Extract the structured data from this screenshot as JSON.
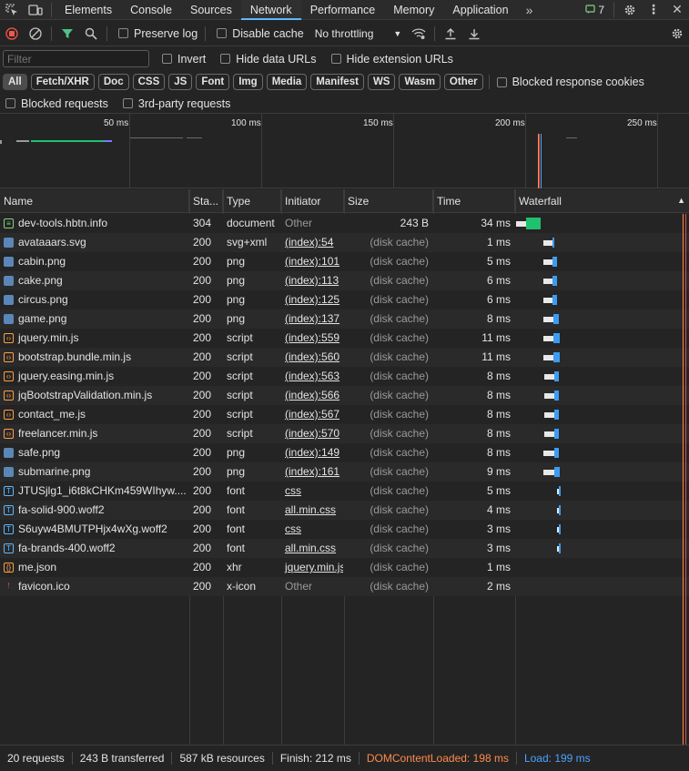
{
  "tabs": [
    "Elements",
    "Console",
    "Sources",
    "Network",
    "Performance",
    "Memory",
    "Application"
  ],
  "active_tab": "Network",
  "issues_count": "7",
  "toolbar": {
    "preserve_log": "Preserve log",
    "disable_cache": "Disable cache",
    "throttling": "No throttling"
  },
  "filter": {
    "placeholder": "Filter",
    "invert": "Invert",
    "hide_data_urls": "Hide data URLs",
    "hide_extension_urls": "Hide extension URLs"
  },
  "type_filters": [
    "All",
    "Fetch/XHR",
    "Doc",
    "CSS",
    "JS",
    "Font",
    "Img",
    "Media",
    "Manifest",
    "WS",
    "Wasm",
    "Other"
  ],
  "blocked_response_cookies": "Blocked response cookies",
  "blocked_requests": "Blocked requests",
  "third_party_requests": "3rd-party requests",
  "overview_ticks": [
    "50 ms",
    "100 ms",
    "150 ms",
    "200 ms",
    "250 ms"
  ],
  "columns": [
    "Name",
    "Sta...",
    "Type",
    "Initiator",
    "Size",
    "Time",
    "Waterfall"
  ],
  "requests": [
    {
      "name": "dev-tools.hbtn.info",
      "status": "304",
      "type": "document",
      "initiator": "Other",
      "size": "243 B",
      "time": "34 ms",
      "icon": "doc",
      "wf_start": 0.0,
      "wf_wait": 0.06,
      "wf_end": 0.14,
      "wf_color": "#1fc06e"
    },
    {
      "name": "avataaars.svg",
      "status": "200",
      "type": "svg+xml",
      "initiator": "(index):54",
      "size": "(disk cache)",
      "time": "1 ms",
      "icon": "img",
      "wf_start": 0.156,
      "wf_wait": 0.21,
      "wf_end": 0.22,
      "wf_color": "#3d9cf0"
    },
    {
      "name": "cabin.png",
      "status": "200",
      "type": "png",
      "initiator": "(index):101",
      "size": "(disk cache)",
      "time": "5 ms",
      "icon": "img",
      "wf_start": 0.156,
      "wf_wait": 0.21,
      "wf_end": 0.235,
      "wf_color": "#3d9cf0"
    },
    {
      "name": "cake.png",
      "status": "200",
      "type": "png",
      "initiator": "(index):113",
      "size": "(disk cache)",
      "time": "6 ms",
      "icon": "img",
      "wf_start": 0.156,
      "wf_wait": 0.21,
      "wf_end": 0.237,
      "wf_color": "#3d9cf0"
    },
    {
      "name": "circus.png",
      "status": "200",
      "type": "png",
      "initiator": "(index):125",
      "size": "(disk cache)",
      "time": "6 ms",
      "icon": "img",
      "wf_start": 0.156,
      "wf_wait": 0.21,
      "wf_end": 0.237,
      "wf_color": "#3d9cf0"
    },
    {
      "name": "game.png",
      "status": "200",
      "type": "png",
      "initiator": "(index):137",
      "size": "(disk cache)",
      "time": "8 ms",
      "icon": "img",
      "wf_start": 0.156,
      "wf_wait": 0.215,
      "wf_end": 0.245,
      "wf_color": "#3d9cf0"
    },
    {
      "name": "jquery.min.js",
      "status": "200",
      "type": "script",
      "initiator": "(index):559",
      "size": "(disk cache)",
      "time": "11 ms",
      "icon": "script",
      "wf_start": 0.156,
      "wf_wait": 0.215,
      "wf_end": 0.255,
      "wf_color": "#3d9cf0"
    },
    {
      "name": "bootstrap.bundle.min.js",
      "status": "200",
      "type": "script",
      "initiator": "(index):560",
      "size": "(disk cache)",
      "time": "11 ms",
      "icon": "script",
      "wf_start": 0.156,
      "wf_wait": 0.215,
      "wf_end": 0.255,
      "wf_color": "#3d9cf0"
    },
    {
      "name": "jquery.easing.min.js",
      "status": "200",
      "type": "script",
      "initiator": "(index):563",
      "size": "(disk cache)",
      "time": "8 ms",
      "icon": "script",
      "wf_start": 0.163,
      "wf_wait": 0.22,
      "wf_end": 0.25,
      "wf_color": "#3d9cf0"
    },
    {
      "name": "jqBootstrapValidation.min.js",
      "status": "200",
      "type": "script",
      "initiator": "(index):566",
      "size": "(disk cache)",
      "time": "8 ms",
      "icon": "script",
      "wf_start": 0.163,
      "wf_wait": 0.22,
      "wf_end": 0.25,
      "wf_color": "#3d9cf0"
    },
    {
      "name": "contact_me.js",
      "status": "200",
      "type": "script",
      "initiator": "(index):567",
      "size": "(disk cache)",
      "time": "8 ms",
      "icon": "script",
      "wf_start": 0.163,
      "wf_wait": 0.22,
      "wf_end": 0.25,
      "wf_color": "#3d9cf0"
    },
    {
      "name": "freelancer.min.js",
      "status": "200",
      "type": "script",
      "initiator": "(index):570",
      "size": "(disk cache)",
      "time": "8 ms",
      "icon": "script",
      "wf_start": 0.163,
      "wf_wait": 0.22,
      "wf_end": 0.25,
      "wf_color": "#3d9cf0"
    },
    {
      "name": "safe.png",
      "status": "200",
      "type": "png",
      "initiator": "(index):149",
      "size": "(disk cache)",
      "time": "8 ms",
      "icon": "img",
      "wf_start": 0.156,
      "wf_wait": 0.22,
      "wf_end": 0.25,
      "wf_color": "#3d9cf0"
    },
    {
      "name": "submarine.png",
      "status": "200",
      "type": "png",
      "initiator": "(index):161",
      "size": "(disk cache)",
      "time": "9 ms",
      "icon": "img",
      "wf_start": 0.156,
      "wf_wait": 0.22,
      "wf_end": 0.252,
      "wf_color": "#3d9cf0"
    },
    {
      "name": "JTUSjlg1_i6t8kCHKm459WIhyw....",
      "status": "200",
      "type": "font",
      "initiator": "css",
      "size": "(disk cache)",
      "time": "5 ms",
      "icon": "font",
      "wf_start": 0.238,
      "wf_wait": 0.245,
      "wf_end": 0.26,
      "wf_color": "#3d9cf0"
    },
    {
      "name": "fa-solid-900.woff2",
      "status": "200",
      "type": "font",
      "initiator": "all.min.css",
      "size": "(disk cache)",
      "time": "4 ms",
      "icon": "font",
      "wf_start": 0.238,
      "wf_wait": 0.245,
      "wf_end": 0.258,
      "wf_color": "#3d9cf0"
    },
    {
      "name": "S6uyw4BMUTPHjx4wXg.woff2",
      "status": "200",
      "type": "font",
      "initiator": "css",
      "size": "(disk cache)",
      "time": "3 ms",
      "icon": "font",
      "wf_start": 0.238,
      "wf_wait": 0.245,
      "wf_end": 0.256,
      "wf_color": "#3d9cf0"
    },
    {
      "name": "fa-brands-400.woff2",
      "status": "200",
      "type": "font",
      "initiator": "all.min.css",
      "size": "(disk cache)",
      "time": "3 ms",
      "icon": "font",
      "wf_start": 0.238,
      "wf_wait": 0.245,
      "wf_end": 0.256,
      "wf_color": "#3d9cf0"
    },
    {
      "name": "me.json",
      "status": "200",
      "type": "xhr",
      "initiator": "jquery.min.js",
      "size": "(disk cache)",
      "time": "1 ms",
      "icon": "xhr",
      "wf_start": -1,
      "wf_wait": 0,
      "wf_end": 0,
      "wf_color": "#3d9cf0"
    },
    {
      "name": "favicon.ico",
      "status": "200",
      "type": "x-icon",
      "initiator": "Other",
      "size": "(disk cache)",
      "time": "2 ms",
      "icon": "favicon",
      "wf_start": -1,
      "wf_wait": 0,
      "wf_end": 0,
      "wf_color": "#3d9cf0"
    }
  ],
  "status": {
    "requests": "20 requests",
    "transferred": "243 B transferred",
    "resources": "587 kB resources",
    "finish": "Finish: 212 ms",
    "dom_loaded": "DOMContentLoaded: 198 ms",
    "load": "Load: 199 ms"
  },
  "colors": {
    "accent": "#5eb8ff",
    "dom_loaded": "#ff8a4c",
    "load": "#4aa3ff",
    "record": "#f4574a",
    "filter": "#4fc08d"
  }
}
